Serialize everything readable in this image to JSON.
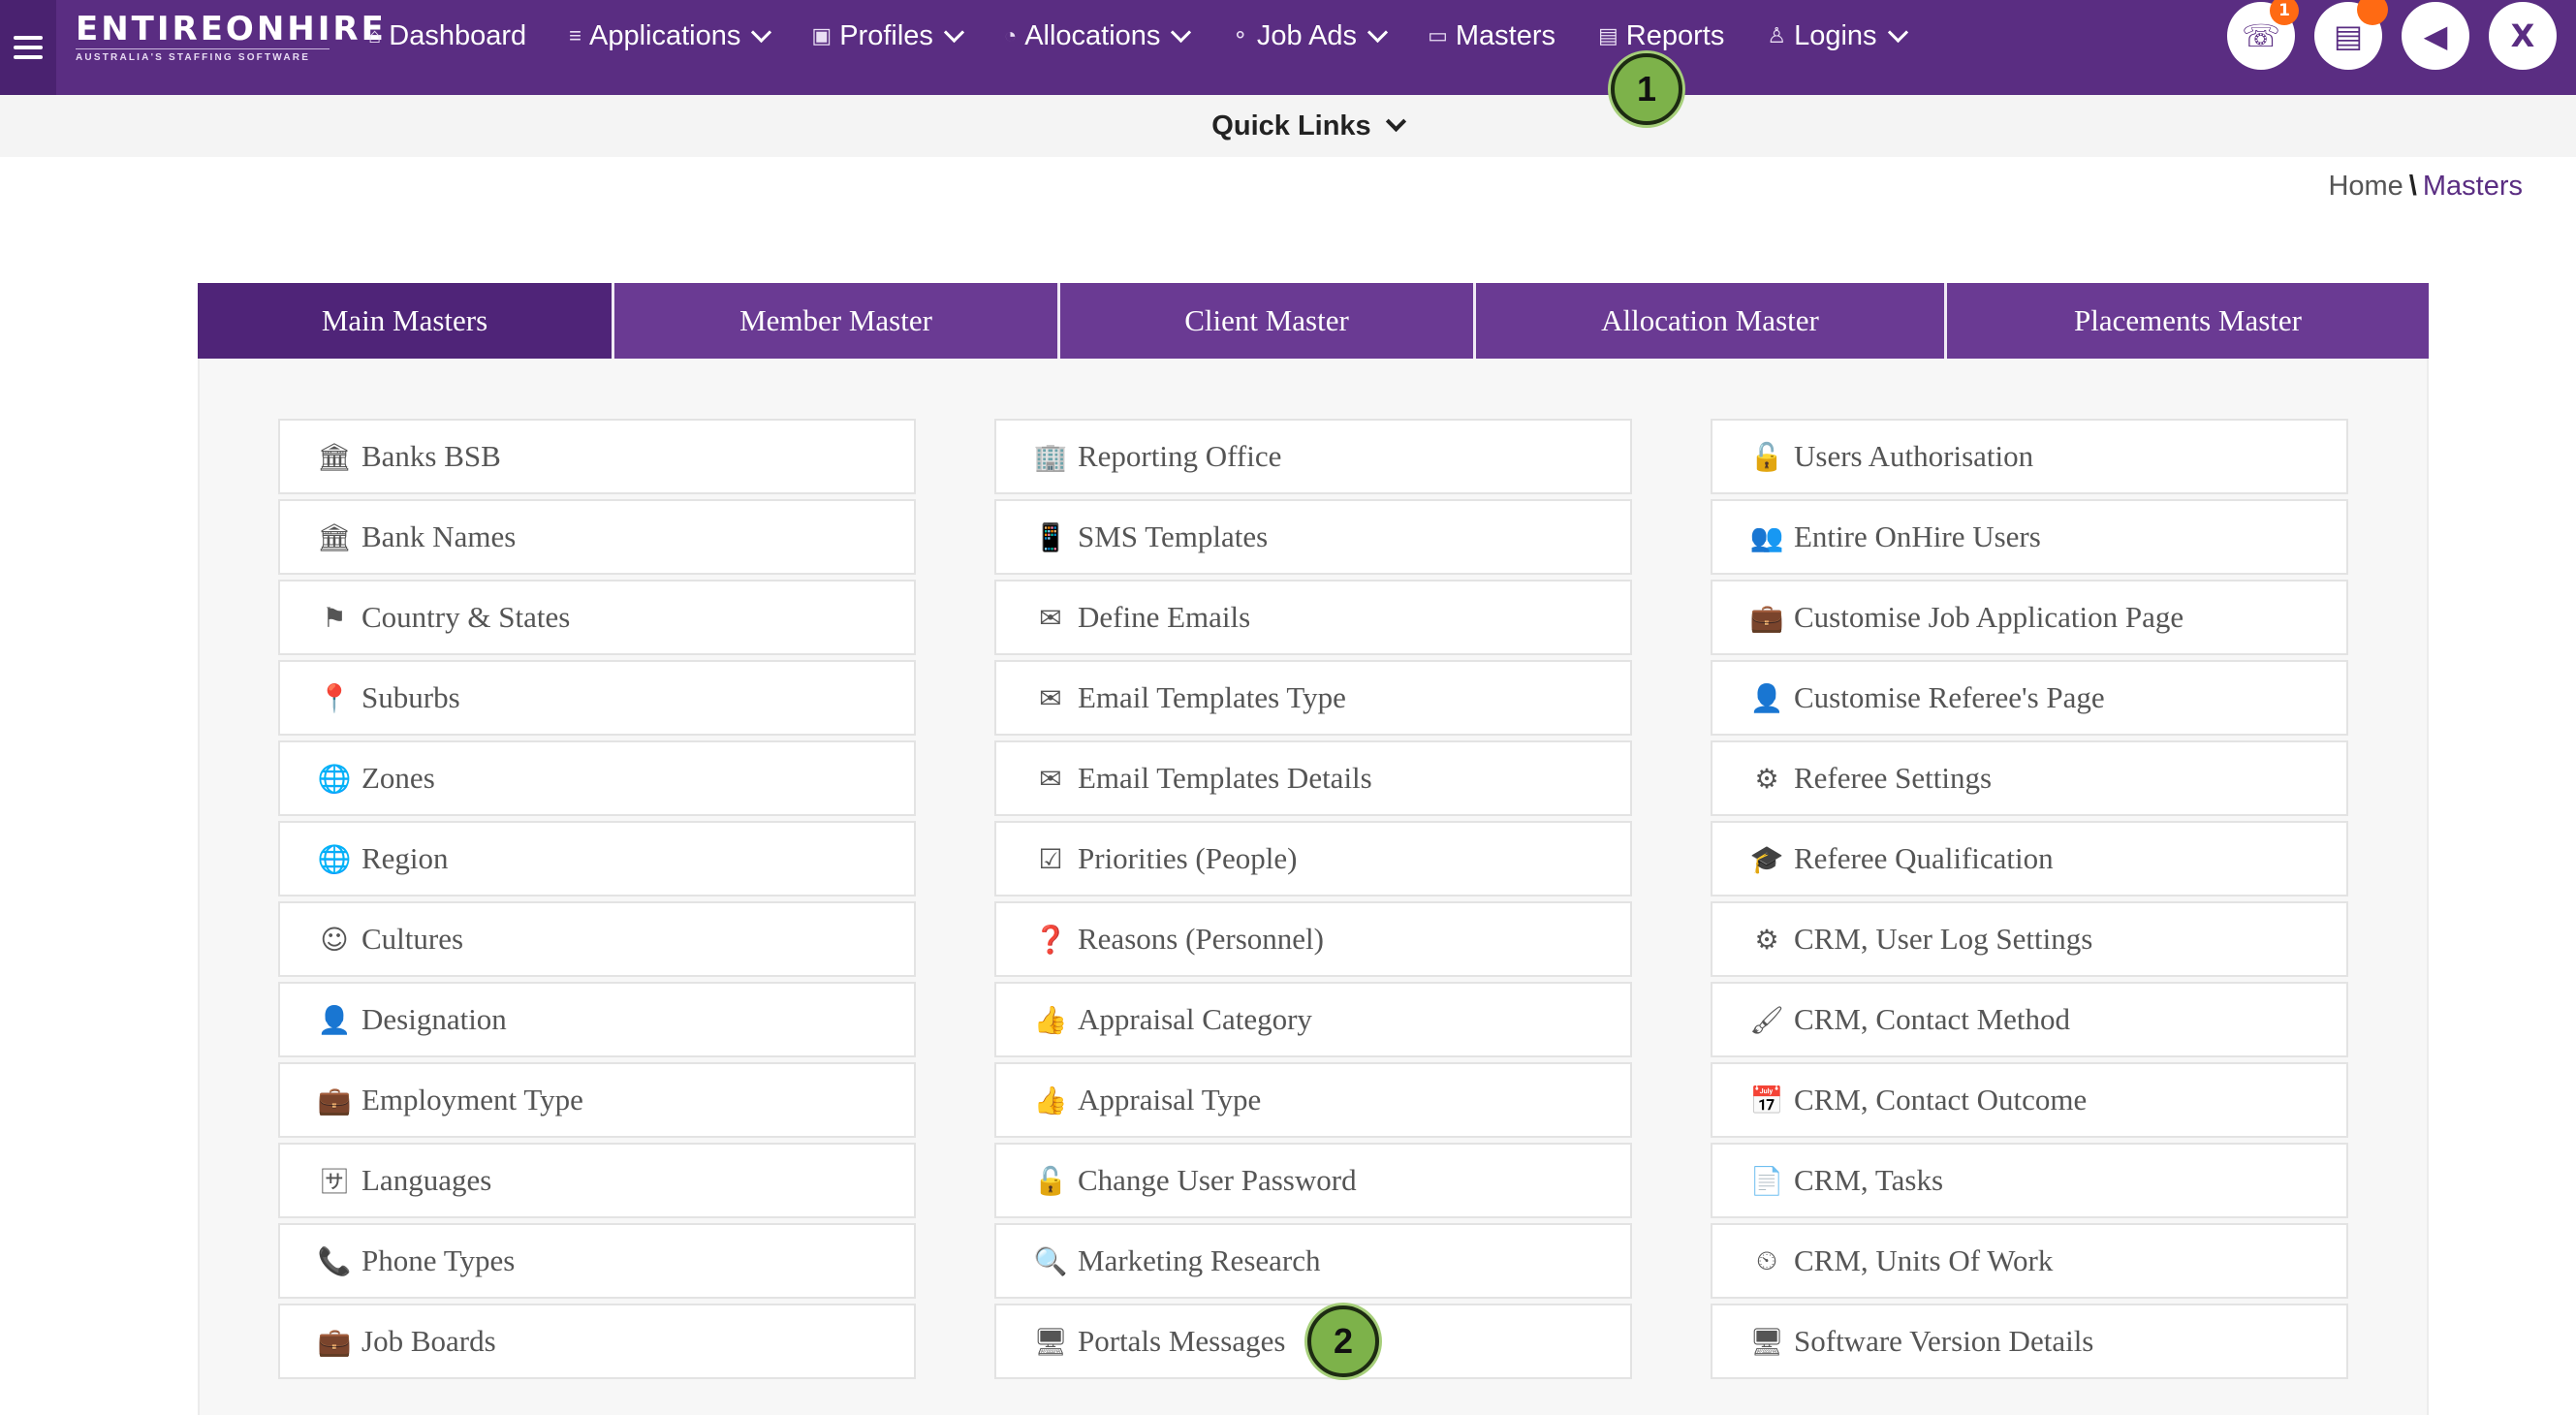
{
  "logo": {
    "word": "ENTIREONHIRE",
    "tagline": "AUSTRALIA'S STAFFING SOFTWARE"
  },
  "nav": [
    {
      "label": "Dashboard",
      "icon": "⌂",
      "caret": false
    },
    {
      "label": "Applications",
      "icon": "≡",
      "caret": true
    },
    {
      "label": "Profiles",
      "icon": "▣",
      "caret": true
    },
    {
      "label": "Allocations",
      "icon": "◔",
      "caret": true
    },
    {
      "label": "Job Ads",
      "icon": "⚬",
      "caret": true
    },
    {
      "label": "Masters",
      "icon": "▭",
      "caret": false
    },
    {
      "label": "Reports",
      "icon": "▤",
      "caret": false
    },
    {
      "label": "Logins",
      "icon": "♙",
      "caret": true
    }
  ],
  "top_icons": {
    "phone": {
      "glyph": "☏",
      "badge": "1"
    },
    "document": {
      "glyph": "▤",
      "badge": ""
    },
    "announce": {
      "glyph": "◀",
      "badge": null
    },
    "user_initial": "X"
  },
  "quick_links": "Quick Links",
  "breadcrumb": {
    "home": "Home",
    "current": "Masters"
  },
  "tabs": [
    "Main Masters",
    "Member Master",
    "Client Master",
    "Allocation Master",
    "Placements Master"
  ],
  "columns": [
    [
      {
        "label": "Banks BSB",
        "icon": "🏛"
      },
      {
        "label": "Bank Names",
        "icon": "🏛"
      },
      {
        "label": "Country & States",
        "icon": "⚑"
      },
      {
        "label": "Suburbs",
        "icon": "📍"
      },
      {
        "label": "Zones",
        "icon": "🌐"
      },
      {
        "label": "Region",
        "icon": "🌐"
      },
      {
        "label": "Cultures",
        "icon": "☺"
      },
      {
        "label": "Designation",
        "icon": "👤"
      },
      {
        "label": "Employment Type",
        "icon": "💼"
      },
      {
        "label": "Languages",
        "icon": "🈂"
      },
      {
        "label": "Phone Types",
        "icon": "📞"
      },
      {
        "label": "Job Boards",
        "icon": "💼"
      }
    ],
    [
      {
        "label": "Reporting Office",
        "icon": "🏢"
      },
      {
        "label": "SMS Templates",
        "icon": "📱"
      },
      {
        "label": "Define Emails",
        "icon": "✉"
      },
      {
        "label": "Email Templates Type",
        "icon": "✉"
      },
      {
        "label": "Email Templates Details",
        "icon": "✉"
      },
      {
        "label": "Priorities (People)",
        "icon": "☑"
      },
      {
        "label": "Reasons (Personnel)",
        "icon": "❓"
      },
      {
        "label": "Appraisal Category",
        "icon": "👍"
      },
      {
        "label": "Appraisal Type",
        "icon": "👍"
      },
      {
        "label": "Change User Password",
        "icon": "🔓"
      },
      {
        "label": "Marketing Research",
        "icon": "🔍"
      },
      {
        "label": "Portals Messages",
        "icon": "🖥"
      }
    ],
    [
      {
        "label": "Users Authorisation",
        "icon": "🔓"
      },
      {
        "label": "Entire OnHire Users",
        "icon": "👥"
      },
      {
        "label": "Customise Job Application Page",
        "icon": "💼"
      },
      {
        "label": "Customise Referee's Page",
        "icon": "👤"
      },
      {
        "label": "Referee Settings",
        "icon": "⚙"
      },
      {
        "label": "Referee Qualification",
        "icon": "🎓"
      },
      {
        "label": "CRM, User Log Settings",
        "icon": "⚙"
      },
      {
        "label": "CRM, Contact Method",
        "icon": "🖌"
      },
      {
        "label": "CRM, Contact Outcome",
        "icon": "📅"
      },
      {
        "label": "CRM, Tasks",
        "icon": "📄"
      },
      {
        "label": "CRM, Units Of Work",
        "icon": "⏲"
      },
      {
        "label": "Software Version Details",
        "icon": "🖥"
      }
    ]
  ],
  "step_markers": [
    "1",
    "2"
  ]
}
